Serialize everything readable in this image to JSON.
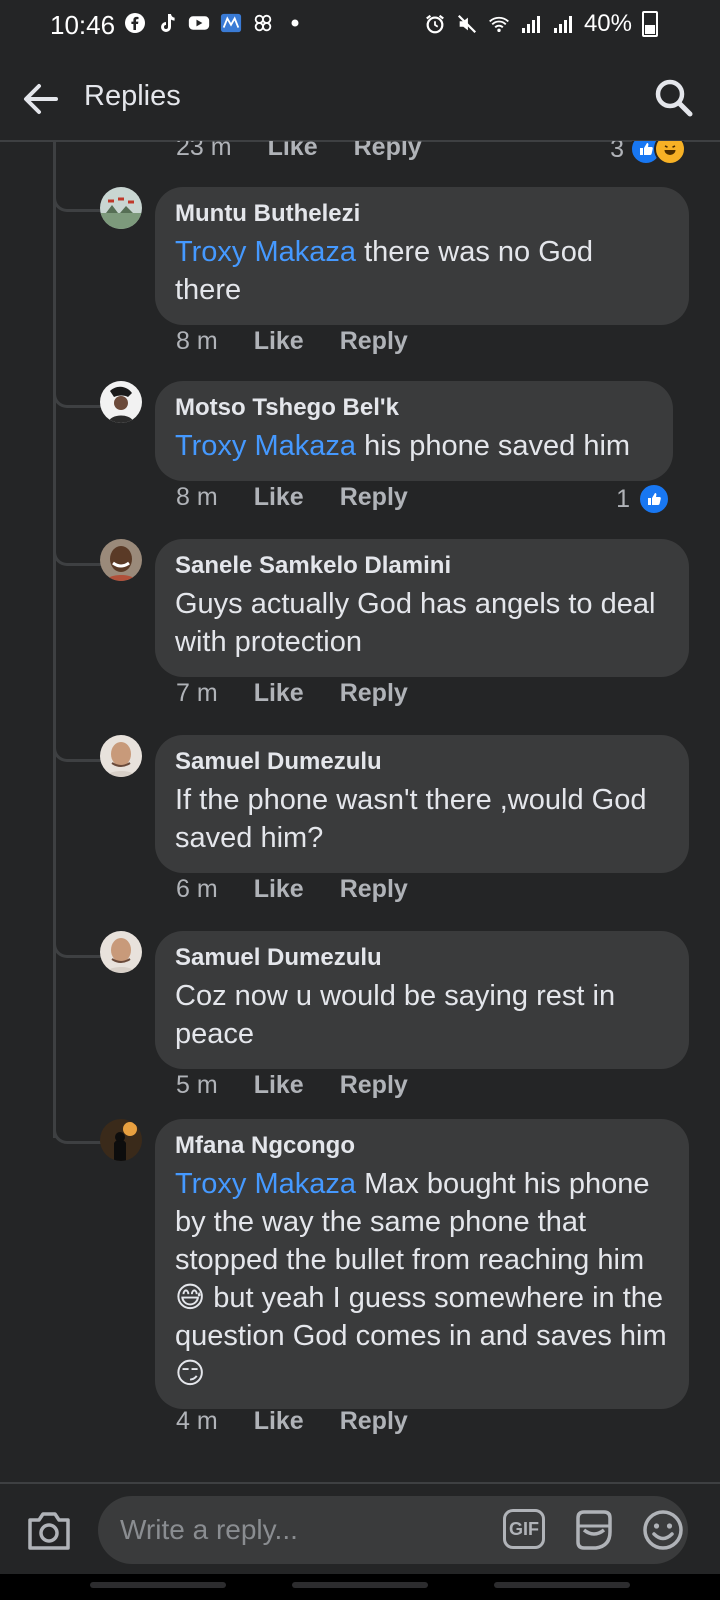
{
  "status_bar": {
    "time": "10:46",
    "battery": "40%",
    "left_icons": [
      "facebook-icon",
      "tiktok-icon",
      "youtube-icon",
      "news-app-icon",
      "pinwheel-icon",
      "dot-icon"
    ],
    "right_icons": [
      "alarm-icon",
      "mute-icon",
      "wifi-icon",
      "signal-icon",
      "signal-icon",
      "battery-icon"
    ]
  },
  "app_bar": {
    "title": "Replies"
  },
  "parent_actions": {
    "time": "23 m",
    "like": "Like",
    "reply": "Reply",
    "reaction_count": "3"
  },
  "comments": [
    {
      "author": "Muntu Buthelezi",
      "mention": "Troxy Makaza",
      "text": " there was no God there",
      "time": "8 m",
      "like": "Like",
      "reply": "Reply",
      "reaction_count": ""
    },
    {
      "author": "Motso Tshego Bel'k",
      "mention": "Troxy Makaza",
      "text": " his phone saved him",
      "time": "8 m",
      "like": "Like",
      "reply": "Reply",
      "reaction_count": "1"
    },
    {
      "author": "Sanele Samkelo Dlamini",
      "mention": "",
      "text": "Guys actually God has angels to deal with protection",
      "time": "7 m",
      "like": "Like",
      "reply": "Reply",
      "reaction_count": ""
    },
    {
      "author": "Samuel Dumezulu",
      "mention": "",
      "text": "If the phone wasn't there ,would God saved him?",
      "time": "6 m",
      "like": "Like",
      "reply": "Reply",
      "reaction_count": ""
    },
    {
      "author": "Samuel Dumezulu",
      "mention": "",
      "text": "Coz now u would be saying rest in peace",
      "time": "5 m",
      "like": "Like",
      "reply": "Reply",
      "reaction_count": ""
    },
    {
      "author": "Mfana Ngcongo",
      "mention": "Troxy Makaza",
      "text": " Max bought his phone by the way the same phone that stopped the bullet from reaching him 😅 but yeah I guess somewhere in the question God comes in and saves him😏",
      "time": "4 m",
      "like": "Like",
      "reply": "Reply",
      "reaction_count": ""
    }
  ],
  "composer": {
    "placeholder": "Write a reply...",
    "gif_label": "GIF"
  },
  "colors": {
    "background": "#242526",
    "bubble": "#3a3b3c",
    "mention": "#4599ff",
    "like_blue": "#1877f2"
  }
}
